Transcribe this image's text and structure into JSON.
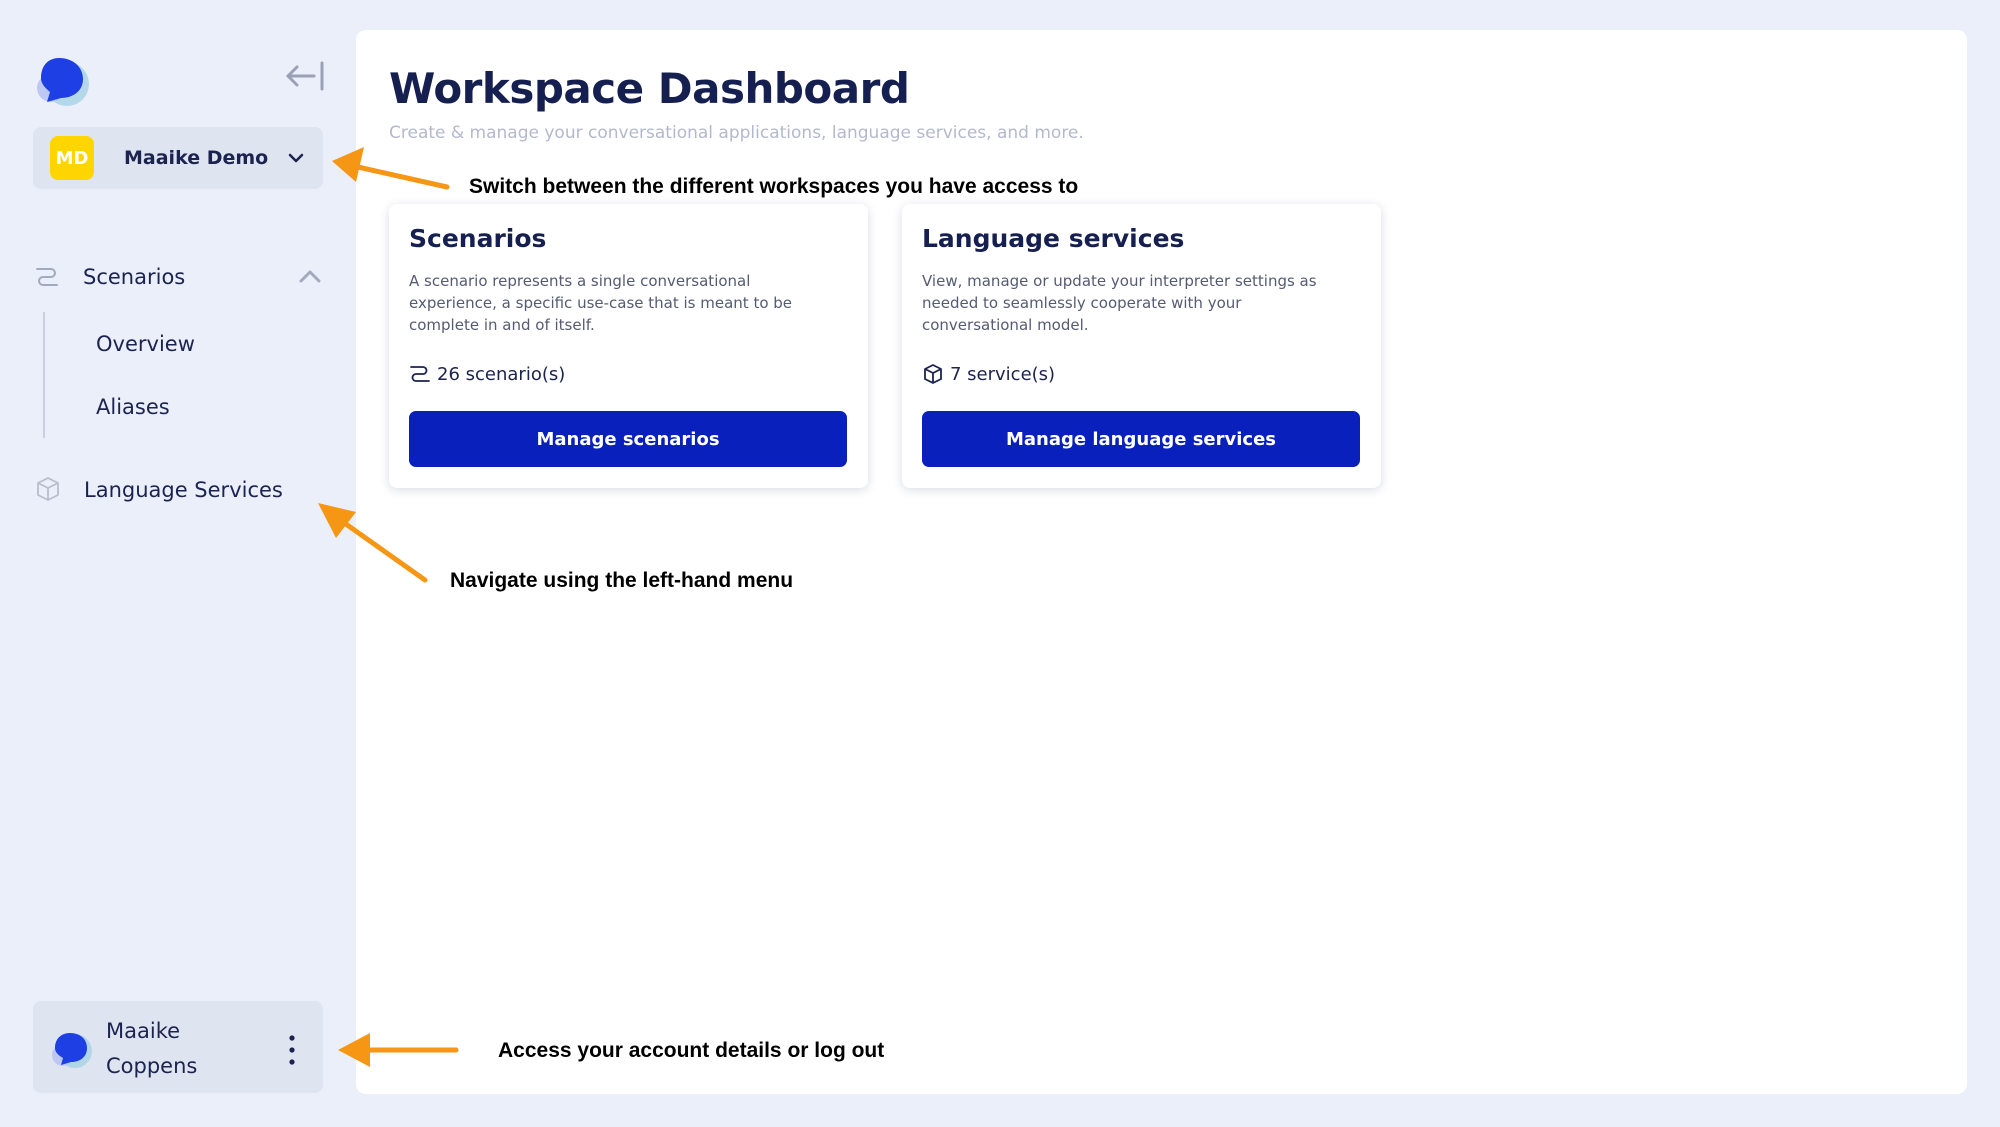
{
  "sidebar": {
    "workspace": {
      "initials": "MD",
      "name": "Maaike Demo"
    },
    "nav": {
      "scenarios": {
        "label": "Scenarios",
        "children": [
          "Overview",
          "Aliases"
        ]
      },
      "language_services": {
        "label": "Language Services"
      }
    },
    "account": {
      "first_name": "Maaike",
      "last_name": "Coppens"
    }
  },
  "main": {
    "title": "Workspace Dashboard",
    "subtitle": "Create & manage your conversational applications, language services, and more.",
    "cards": [
      {
        "title": "Scenarios",
        "description": "A scenario represents a single conversational experience, a specific use-case that is meant to be complete in and of itself.",
        "stat": "26 scenario(s)",
        "button": "Manage scenarios"
      },
      {
        "title": "Language services",
        "description": "View, manage or update your interpreter settings as needed to seamlessly cooperate with your conversational model.",
        "stat": "7 service(s)",
        "button": "Manage language services"
      }
    ]
  },
  "annotations": {
    "workspace": "Switch between the different workspaces you have access to",
    "navigation": "Navigate using the left-hand menu",
    "account": "Access your account details or log out"
  },
  "colors": {
    "background": "#ebeffa",
    "accent_button": "#0920bc",
    "workspace_avatar": "#ffd500",
    "annotation_arrow": "#f59614"
  },
  "icons": {
    "logo": "chat-bubble-logo",
    "collapse": "collapse-sidebar-icon",
    "workspace_toggle": "chevron-down-icon",
    "scenarios": "route-icon",
    "scenarios_toggle": "chevron-up-icon",
    "language_services": "cube-icon",
    "account_menu": "more-vertical-icon"
  }
}
